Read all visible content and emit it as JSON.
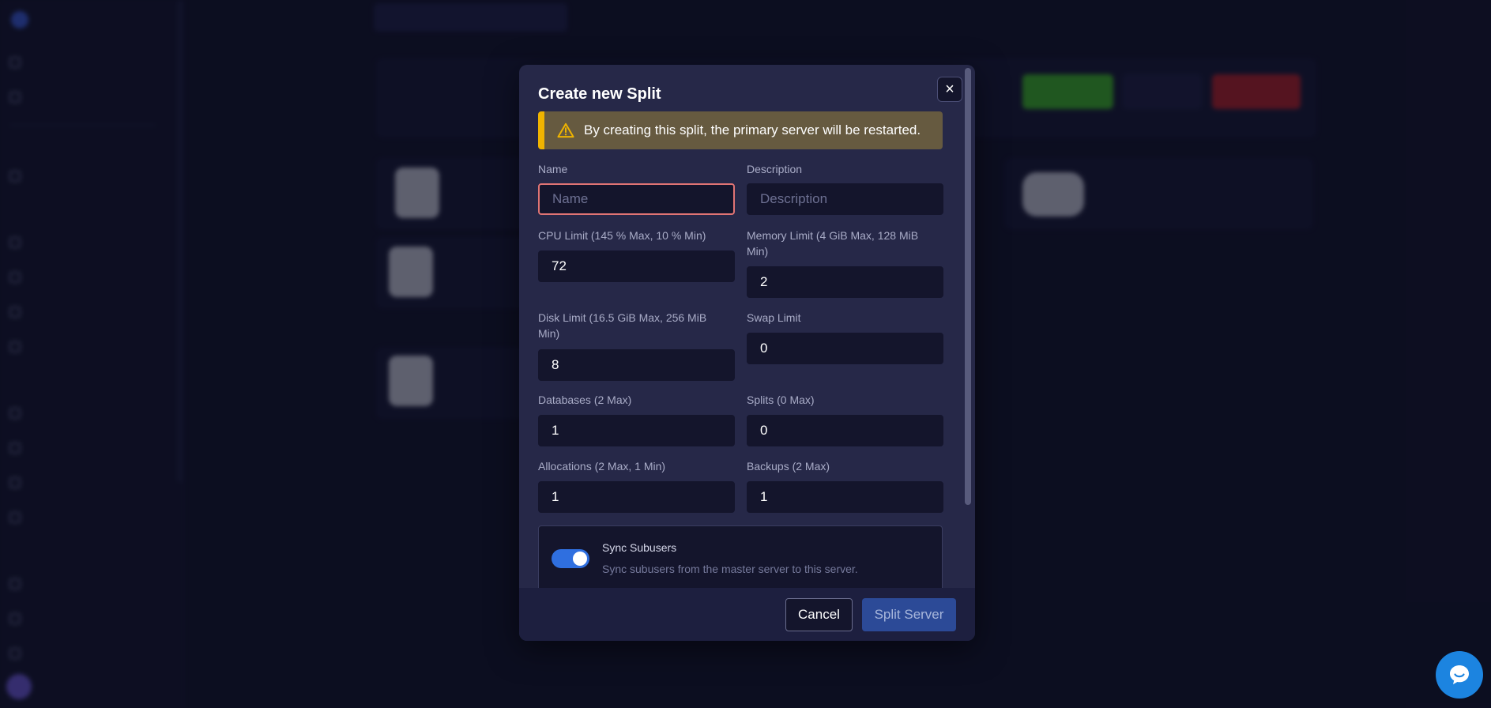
{
  "modal": {
    "title": "Create new Split",
    "close_label": "×",
    "alert": "By creating this split, the primary server will be restarted.",
    "fields": {
      "name": {
        "label": "Name",
        "placeholder": "Name",
        "value": ""
      },
      "description": {
        "label": "Description",
        "placeholder": "Description",
        "value": ""
      },
      "cpu": {
        "label": "CPU Limit (145 % Max, 10 % Min)",
        "value": "72"
      },
      "memory": {
        "label": "Memory Limit (4 GiB Max, 128 MiB Min)",
        "value": "2"
      },
      "disk": {
        "label": "Disk Limit (16.5 GiB Max, 256 MiB Min)",
        "value": "8"
      },
      "swap": {
        "label": "Swap Limit",
        "value": "0"
      },
      "databases": {
        "label": "Databases (2 Max)",
        "value": "1"
      },
      "splits": {
        "label": "Splits (0 Max)",
        "value": "0"
      },
      "allocations": {
        "label": "Allocations (2 Max, 1 Min)",
        "value": "1"
      },
      "backups": {
        "label": "Backups (2 Max)",
        "value": "1"
      }
    },
    "sync": {
      "title": "Sync Subusers",
      "description": "Sync subusers from the master server to this server.",
      "enabled": true
    },
    "buttons": {
      "cancel": "Cancel",
      "submit": "Split Server"
    }
  },
  "colors": {
    "accent": "#2f6fe0",
    "warning": "#f0b400",
    "focus_border": "#e07474",
    "chat": "#1c84e0"
  },
  "icons": {
    "close": "close-icon",
    "warning": "warning-triangle-icon",
    "chat": "chat-bubble-icon"
  }
}
